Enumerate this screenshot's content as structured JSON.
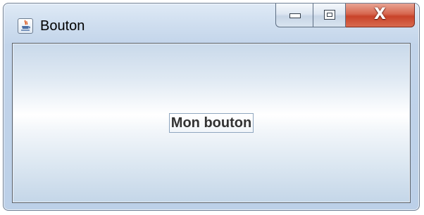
{
  "window": {
    "title": "Bouton",
    "caption_buttons": {
      "minimize_icon": "minimize-icon",
      "maximize_icon": "maximize-icon",
      "close_glyph": "X",
      "close_color": "#c8432a"
    }
  },
  "content": {
    "button_label": "Mon bouton"
  }
}
